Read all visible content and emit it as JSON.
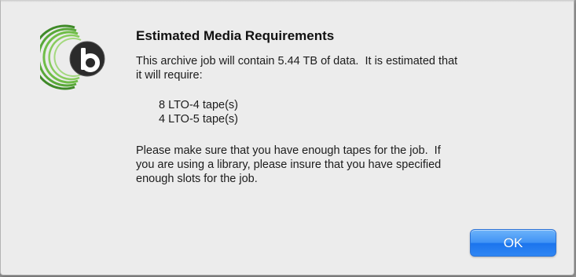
{
  "dialog": {
    "title": "Estimated Media Requirements",
    "message_line1": "This archive job will contain 5.44 TB of data.  It is estimated that",
    "message_line2": "it will require:",
    "tapes": [
      "8 LTO-4 tape(s)",
      "4 LTO-5 tape(s)"
    ],
    "note_line1": "Please make sure that you have enough tapes for the job.  If",
    "note_line2": "you are using a library, please insure that you have specified",
    "note_line3": "enough slots for the job.",
    "ok_label": "OK"
  },
  "logo": {
    "letter": "b",
    "colors": {
      "outer_arcs": "#4a9a2e",
      "inner_arcs": "#7cc44f",
      "badge": "#2d2d2d",
      "badge_letter": "#ffffff"
    }
  },
  "colors": {
    "dialog_background": "#ececec",
    "button_blue": "#2f86f3"
  }
}
